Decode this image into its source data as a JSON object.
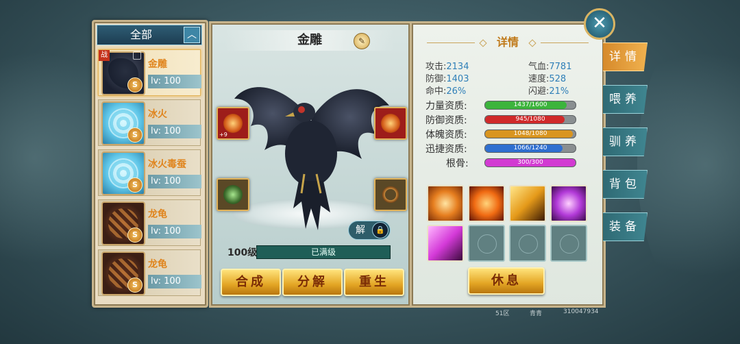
{
  "list_panel": {
    "filter_label": "全部",
    "filter_caret": "︿",
    "pets": [
      {
        "name": "金雕",
        "level": "lv: 100",
        "grade": "S",
        "tag": "战",
        "thumb": "eagle",
        "selected": true
      },
      {
        "name": "冰火",
        "level": "lv: 100",
        "grade": "S",
        "tag": "",
        "thumb": "ice",
        "selected": false
      },
      {
        "name": "冰火毒蚕",
        "level": "lv: 100",
        "grade": "S",
        "tag": "",
        "thumb": "ice",
        "selected": false
      },
      {
        "name": "龙龟",
        "level": "lv: 100",
        "grade": "S",
        "tag": "",
        "thumb": "turtle",
        "selected": false
      },
      {
        "name": "龙龟",
        "level": "lv: 100",
        "grade": "S",
        "tag": "",
        "thumb": "turtle",
        "selected": false
      }
    ]
  },
  "model_panel": {
    "pet_name": "金雕",
    "rename_icon": "pencil-icon",
    "equip_plus": "+9",
    "unlock_label": "解",
    "unlock_icon": "lock-icon",
    "level_label": "100级",
    "max_label": "已满级",
    "buttons": {
      "merge": "合成",
      "decompose": "分解",
      "rebirth": "重生"
    }
  },
  "detail_panel": {
    "title": "详情",
    "stats": {
      "attack_label": "攻击:",
      "attack": "2134",
      "hp_label": "气血:",
      "hp": "7781",
      "defense_label": "防御:",
      "defense": "1403",
      "speed_label": "速度:",
      "speed": "528",
      "hit_label": "命中:",
      "hit": "26%",
      "dodge_label": "闪避:",
      "dodge": "21%"
    },
    "aptitudes": [
      {
        "label": "力量资质:",
        "text": "1437/1600",
        "value": 1437,
        "max": 1600,
        "color": "#3cb43c"
      },
      {
        "label": "防御资质:",
        "text": "945/1080",
        "value": 945,
        "max": 1080,
        "color": "#d02a2a"
      },
      {
        "label": "体魄资质:",
        "text": "1048/1080",
        "value": 1048,
        "max": 1080,
        "color": "#d9951f"
      },
      {
        "label": "迅捷资质:",
        "text": "1066/1240",
        "value": 1066,
        "max": 1240,
        "color": "#2f6fd0"
      },
      {
        "label": "根骨:",
        "text": "300/300",
        "value": 300,
        "max": 300,
        "color": "#d23ad2"
      }
    ],
    "rest_button": "休息"
  },
  "tabs": [
    {
      "label": "详情",
      "active": true
    },
    {
      "label": "喂养",
      "active": false
    },
    {
      "label": "驯养",
      "active": false
    },
    {
      "label": "背包",
      "active": false
    },
    {
      "label": "装备",
      "active": false
    }
  ],
  "close_icon": "close-icon",
  "close_symbol": "✕",
  "footer": {
    "server": "51区",
    "player": "青青",
    "id": "310047934"
  }
}
